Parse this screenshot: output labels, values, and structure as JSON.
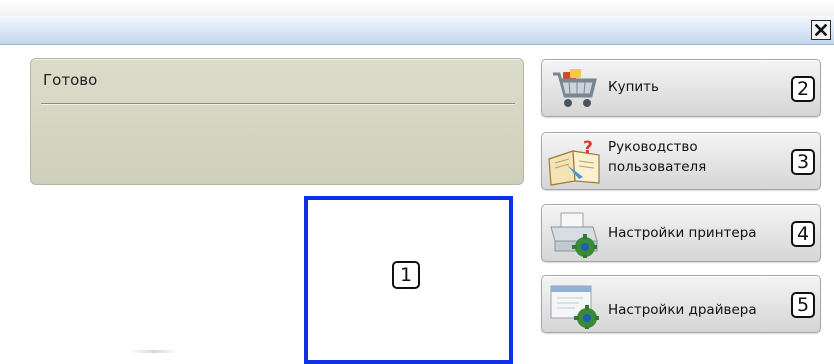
{
  "window": {
    "close_glyph": "✕"
  },
  "status": {
    "text": "Готово"
  },
  "callout": {
    "number": "1"
  },
  "buttons": [
    {
      "label_line1": "Купить",
      "label_line2": "",
      "number": "2",
      "icon": "shopping-cart-icon"
    },
    {
      "label_line1": "Руководство",
      "label_line2": "пользователя",
      "number": "3",
      "icon": "user-guide-book-icon"
    },
    {
      "label_line1": "Настройки принтера",
      "label_line2": "",
      "number": "4",
      "icon": "printer-settings-icon"
    },
    {
      "label_line1": "Настройки драйвера",
      "label_line2": "",
      "number": "5",
      "icon": "driver-settings-icon"
    }
  ],
  "colors": {
    "highlight": "#1030e6",
    "status_panel": "#d4d5c1"
  }
}
